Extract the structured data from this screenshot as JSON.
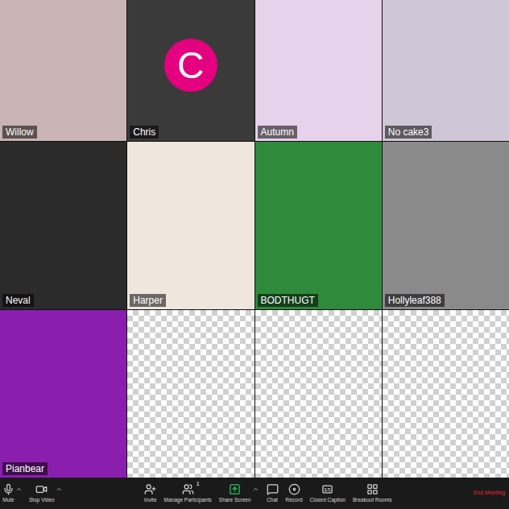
{
  "meeting": {
    "tiles": [
      {
        "kind": "video",
        "name": "Willow",
        "color": "#c9b3b4"
      },
      {
        "kind": "avatar",
        "name": "Chris",
        "avatar": "C",
        "avatar_color": "#e5007f",
        "color": "#3a3a3a"
      },
      {
        "kind": "video",
        "name": "Autumn",
        "color": "#e6d2ea"
      },
      {
        "kind": "video",
        "name": "No cake3",
        "color": "#cfc6d6"
      },
      {
        "kind": "video",
        "name": "Neval",
        "color": "#2b2b2b"
      },
      {
        "kind": "video",
        "name": "Harper",
        "color": "#efe6dc"
      },
      {
        "kind": "video",
        "name": "BODTHUGT",
        "color": "#2f8a3c"
      },
      {
        "kind": "video",
        "name": "Hollyleaf388",
        "color": "#8a8a8a"
      },
      {
        "kind": "video",
        "name": "Pianbear",
        "color": "#8a1fae"
      },
      {
        "kind": "empty"
      },
      {
        "kind": "empty"
      },
      {
        "kind": "empty"
      }
    ]
  },
  "toolbar": {
    "left": [
      {
        "label": "Mute",
        "icon": "mic",
        "menu": true
      },
      {
        "label": "Stop Video",
        "icon": "video",
        "menu": true
      }
    ],
    "center": [
      {
        "label": "Invite",
        "icon": "invite",
        "menu": false,
        "highlight": false
      },
      {
        "label": "Manage Participants",
        "icon": "participants",
        "menu": false,
        "highlight": false,
        "badge": "1"
      },
      {
        "label": "Share Screen",
        "icon": "share",
        "menu": true,
        "highlight": true
      },
      {
        "label": "Chat",
        "icon": "chat",
        "menu": false,
        "highlight": false
      },
      {
        "label": "Record",
        "icon": "record",
        "menu": false,
        "highlight": false
      },
      {
        "label": "Closed Caption",
        "icon": "cc",
        "menu": false,
        "highlight": false
      },
      {
        "label": "Breakout Rooms",
        "icon": "breakout",
        "menu": false,
        "highlight": false
      }
    ],
    "end": "End Meeting"
  }
}
